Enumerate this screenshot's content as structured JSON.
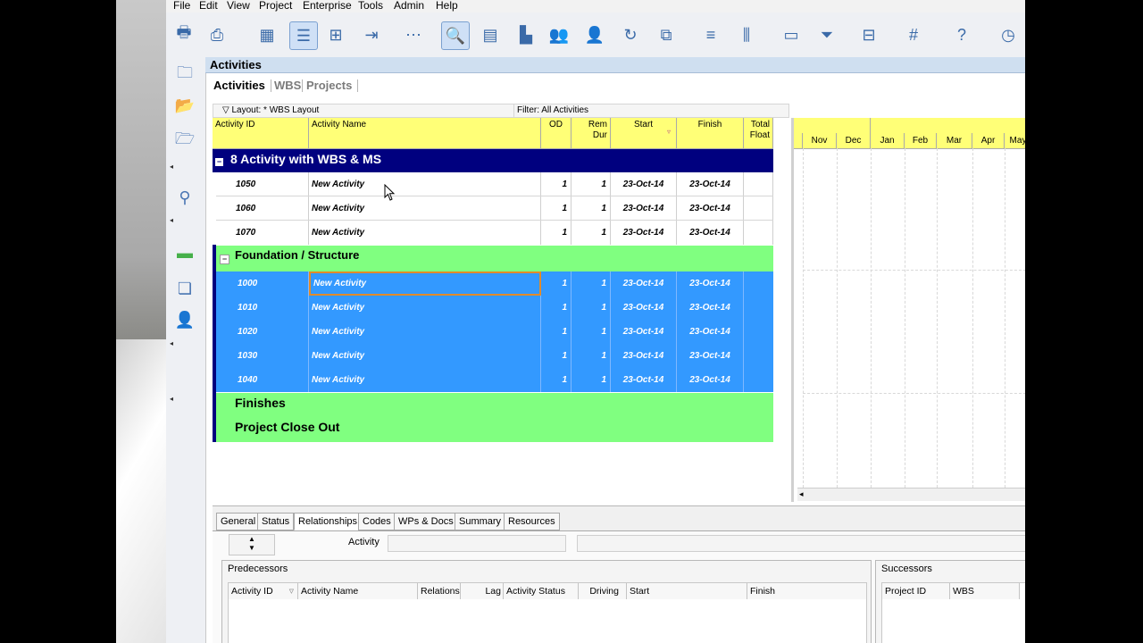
{
  "menu": [
    "File",
    "Edit",
    "View",
    "Project",
    "Enterprise",
    "Tools",
    "Admin",
    "Help"
  ],
  "panel_title": "Activities",
  "tabs": {
    "activities": "Activities",
    "wbs": "WBS",
    "projects": "Projects"
  },
  "layout_label": "Layout: * WBS Layout",
  "filter_label": "Filter: All Activities",
  "columns": {
    "activity_id": "Activity ID",
    "activity_name": "Activity Name",
    "od": "OD",
    "rem_dur_1": "Rem",
    "rem_dur_2": "Dur",
    "start": "Start",
    "finish": "Finish",
    "total_float_1": "Total",
    "total_float_2": "Float"
  },
  "wbs": {
    "project": "8 Activity with WBS & MS",
    "foundation": "Foundation / Structure",
    "finishes": "Finishes",
    "closeout": "Project Close Out"
  },
  "activities_top": [
    {
      "id": "1050",
      "name": "New Activity",
      "od": "1",
      "rem": "1",
      "start": "23-Oct-14",
      "finish": "23-Oct-14"
    },
    {
      "id": "1060",
      "name": "New Activity",
      "od": "1",
      "rem": "1",
      "start": "23-Oct-14",
      "finish": "23-Oct-14"
    },
    {
      "id": "1070",
      "name": "New Activity",
      "od": "1",
      "rem": "1",
      "start": "23-Oct-14",
      "finish": "23-Oct-14"
    }
  ],
  "activities_found": [
    {
      "id": "1000",
      "name": "New Activity",
      "od": "1",
      "rem": "1",
      "start": "23-Oct-14",
      "finish": "23-Oct-14"
    },
    {
      "id": "1010",
      "name": "New Activity",
      "od": "1",
      "rem": "1",
      "start": "23-Oct-14",
      "finish": "23-Oct-14"
    },
    {
      "id": "1020",
      "name": "New Activity",
      "od": "1",
      "rem": "1",
      "start": "23-Oct-14",
      "finish": "23-Oct-14"
    },
    {
      "id": "1030",
      "name": "New Activity",
      "od": "1",
      "rem": "1",
      "start": "23-Oct-14",
      "finish": "23-Oct-14"
    },
    {
      "id": "1040",
      "name": "New Activity",
      "od": "1",
      "rem": "1",
      "start": "23-Oct-14",
      "finish": "23-Oct-14"
    }
  ],
  "gantt_months": [
    "Nov",
    "Dec",
    "Jan",
    "Feb",
    "Mar",
    "Apr",
    "May"
  ],
  "bottom_tabs": [
    "General",
    "Status",
    "Relationships",
    "Codes",
    "WPs & Docs",
    "Summary",
    "Resources"
  ],
  "activity_label": "Activity",
  "predecessors": {
    "title": "Predecessors",
    "columns": [
      "Activity ID",
      "Activity Name",
      "Relations",
      "Lag",
      "Activity Status",
      "Driving",
      "Start",
      "Finish"
    ]
  },
  "successors": {
    "title": "Successors",
    "columns": [
      "Project ID",
      "WBS"
    ]
  },
  "colors": {
    "header_yellow": "#ffff77",
    "wbs_navy": "#00007f",
    "wbs_green": "#80ff80",
    "selected_blue": "#3399ff"
  }
}
